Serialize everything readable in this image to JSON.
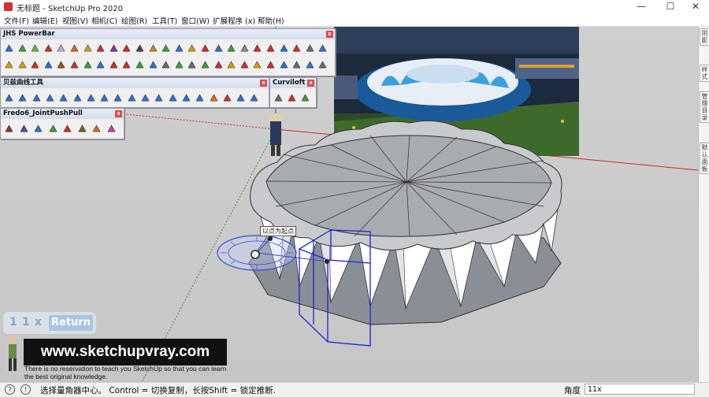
{
  "window": {
    "title": "无标题 - SketchUp Pro 2020",
    "controls": [
      "—",
      "☐",
      "✕"
    ]
  },
  "menu": [
    "文件(F)",
    "编辑(E)",
    "视图(V)",
    "相机(C)",
    "绘图(R)",
    "工具(T)",
    "窗口(W)",
    "扩展程序 (x)",
    "帮助(H)"
  ],
  "toolbars": {
    "powerbar": {
      "title": "JHS PowerBar",
      "row1": [
        "#2f6fd1",
        "#3a9f3a",
        "#6ab83a",
        "#c9302c",
        "#b0b0c8",
        "#d46a1e",
        "#c8a030",
        "#c9302c",
        "#7a3aa0",
        "#c9302c",
        "#444444",
        "#c98a20",
        "#3a9f3a",
        "#2f6fd1",
        "#d4a000",
        "#c9302c",
        "#2f6fd1",
        "#3a9f3a",
        "#8a8a8a",
        "#c9302c",
        "#c9302c",
        "#2f6fd1",
        "#c9302c",
        "#6a6a6a",
        "#2f6fd1"
      ],
      "row2": [
        "#d4a000",
        "#d4a000",
        "#c9302c",
        "#2f6fd1",
        "#8a5a2a",
        "#c9302c",
        "#3a9f3a",
        "#2f6fd1",
        "#c9302c",
        "#c9302c",
        "#3a9f3a",
        "#2f6fd1",
        "#6a6a6a",
        "#3a9f3a",
        "#6a6a6a",
        "#3a9f3a",
        "#c9302c",
        "#d4a000",
        "#c9302c",
        "#d4a000",
        "#c9302c",
        "#2f6fd1",
        "#6a6a6a",
        "#2f6fd1",
        "#6a6a6a"
      ]
    },
    "bezier": {
      "title": "贝兹曲线工具",
      "icons": [
        "#2f6fd1",
        "#2f6fd1",
        "#2f6fd1",
        "#2f6fd1",
        "#2f6fd1",
        "#2f6fd1",
        "#2f6fd1",
        "#2f6fd1",
        "#2f6fd1",
        "#2f6fd1",
        "#2f6fd1",
        "#2f6fd1",
        "#2f6fd1",
        "#2f6fd1",
        "#2f6fd1",
        "#d46a1e",
        "#c9302c",
        "#2f6fd1",
        "#2f6fd1"
      ]
    },
    "curviloft": {
      "title": "Curviloft",
      "icons": [
        "#6a6a6a",
        "#c9302c",
        "#3a9f3a"
      ]
    },
    "fredo": {
      "title": "Fredo6_JointPushPull",
      "icons": [
        "#8a3a2a",
        "#5a4a8a",
        "#2f6fd1",
        "#3a9f3a",
        "#c9302c",
        "#6a6a2a",
        "#d46a1e",
        "#c93ab0"
      ]
    }
  },
  "right_tabs": [
    "阴影",
    "样式",
    "管理目录",
    "默认面板"
  ],
  "hud": {
    "digits": [
      "1",
      "1",
      "x"
    ],
    "return_label": "Return"
  },
  "tooltip": "以点为起点",
  "banner": {
    "title": "www.sketchupvray.com",
    "subtitle": "There is no reservation to teach you SketchUp so that you can learn the best original knowledge."
  },
  "status": {
    "message": "选择量角器中心。 Control = 切换复制，长按Shift = 锁定推断.",
    "measure_label": "角度",
    "measure_value": "11x"
  }
}
